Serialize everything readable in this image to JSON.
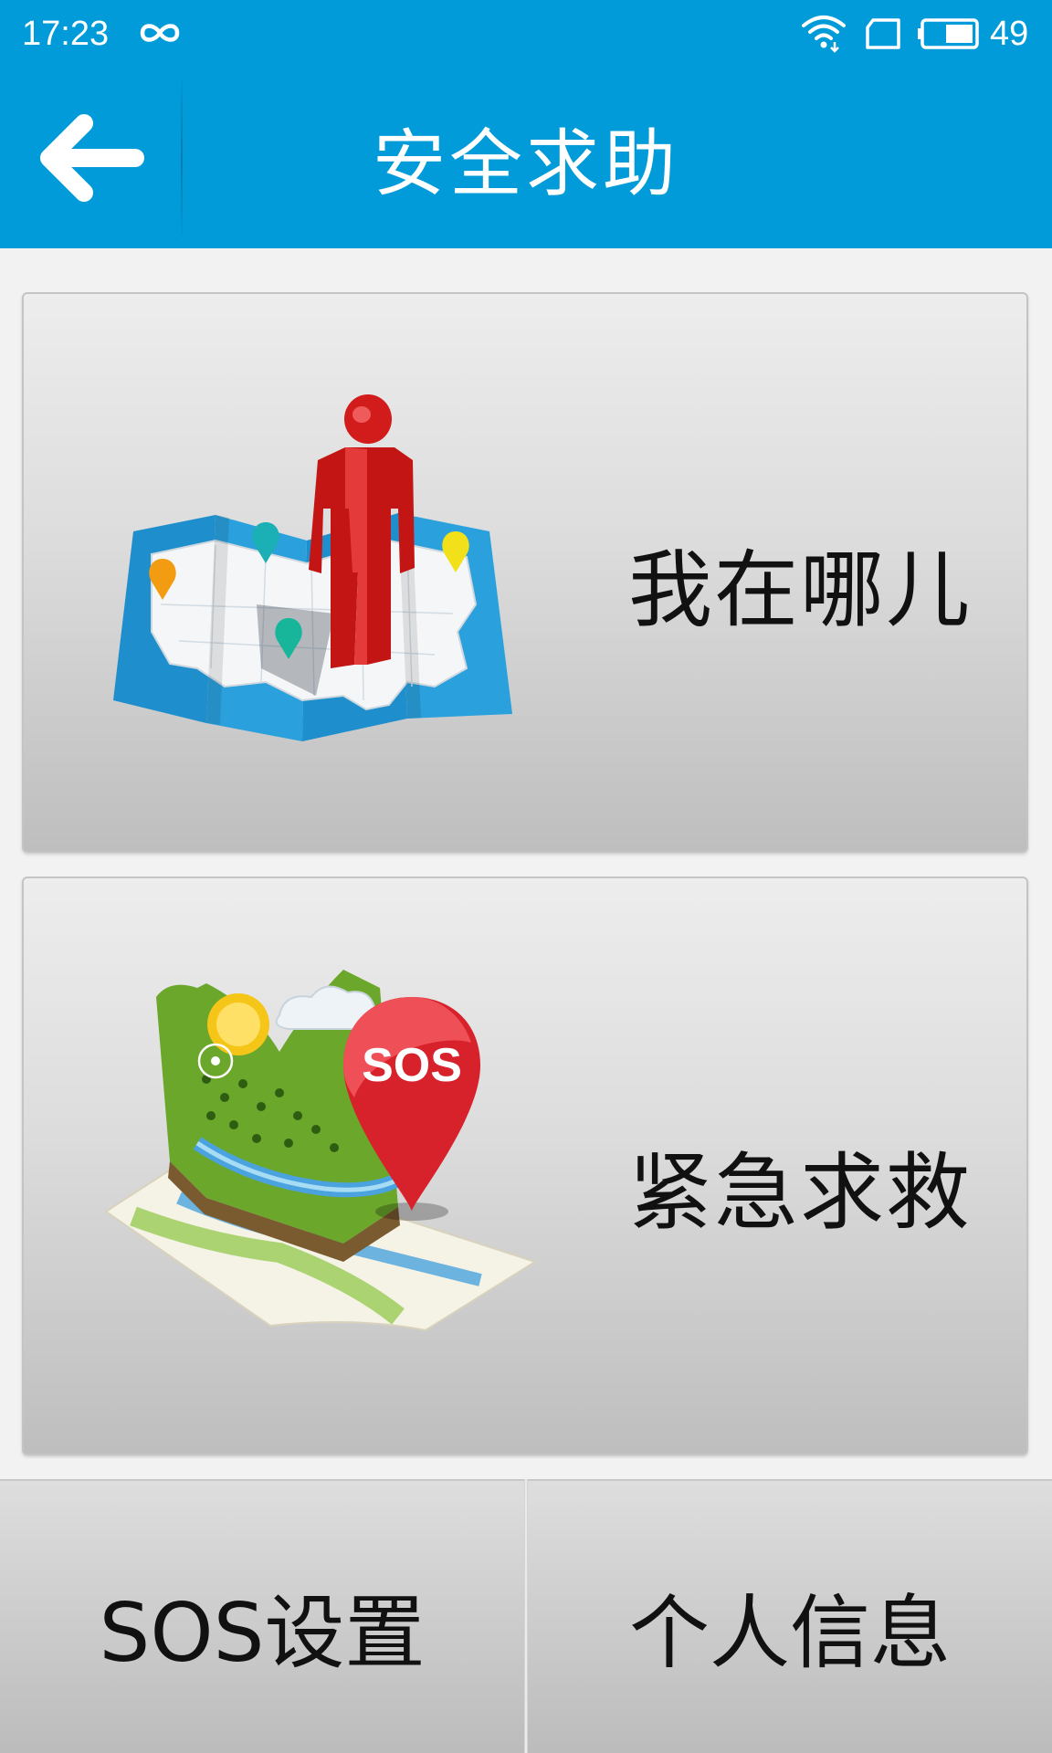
{
  "status_bar": {
    "time": "17:23",
    "battery_percent": "49",
    "icons": [
      "infinity-icon",
      "wifi-icon",
      "sim-card-icon",
      "battery-icon"
    ]
  },
  "header": {
    "title": "安全求助",
    "back_icon": "arrow-left-icon"
  },
  "main": {
    "cards": [
      {
        "label": "我在哪儿",
        "illustration": "map-location-person-illustration"
      },
      {
        "label": "紧急求救",
        "illustration": "sos-map-pin-illustration",
        "badge_text": "SOS"
      }
    ]
  },
  "bottom_bar": {
    "buttons": [
      {
        "label": "SOS设置"
      },
      {
        "label": "个人信息"
      }
    ]
  },
  "colors": {
    "header_blue": "#009bd8",
    "background": "#f2f2f2",
    "card_gradient_top": "#ededed",
    "card_gradient_bottom": "#bebebe",
    "text": "#111111"
  }
}
